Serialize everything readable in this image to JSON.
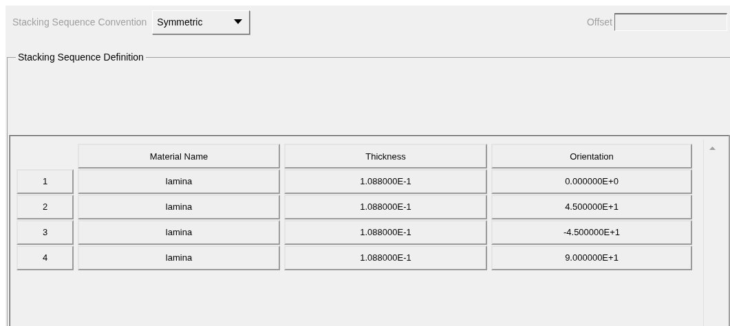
{
  "convention": {
    "label": "Stacking Sequence Convention",
    "disabled": true,
    "value": "Symmetric"
  },
  "offset": {
    "label": "Offset",
    "disabled": true
  },
  "group": {
    "title": "Stacking Sequence Definition"
  },
  "table": {
    "columns": [
      "Material Name",
      "Thickness",
      "Orientation"
    ],
    "rows": [
      {
        "number": "1",
        "cells": [
          "lamina",
          "1.088000E-1",
          "0.000000E+0"
        ]
      },
      {
        "number": "2",
        "cells": [
          "lamina",
          "1.088000E-1",
          "4.500000E+1"
        ]
      },
      {
        "number": "3",
        "cells": [
          "lamina",
          "1.088000E-1",
          "-4.500000E+1"
        ]
      },
      {
        "number": "4",
        "cells": [
          "lamina",
          "1.088000E-1",
          "9.000000E+1"
        ]
      }
    ]
  }
}
